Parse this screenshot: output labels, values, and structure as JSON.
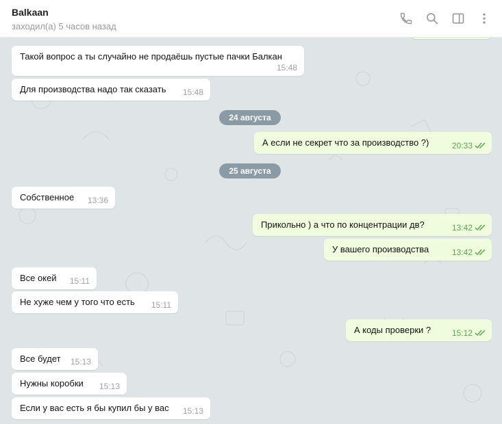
{
  "header": {
    "name": "Balkaan",
    "status": "заходил(а) 5 часов назад"
  },
  "dates": [
    "24 августа",
    "25 августа"
  ],
  "messages": [
    {
      "side": "in",
      "text": "Такой вопрос а ты случайно не продаёшь пустые пачки Балкан",
      "time": "15:48"
    },
    {
      "side": "in",
      "text": "Для производства надо так сказать",
      "time": "15:48"
    },
    {
      "side": "out",
      "text": "А если не секрет что за производство ?)",
      "time": "20:33"
    },
    {
      "side": "in",
      "text": "Собственное",
      "time": "13:36"
    },
    {
      "side": "out",
      "text": "Прикольно ) а что по концентрации дв?",
      "time": "13:42"
    },
    {
      "side": "out",
      "text": "У вашего производства",
      "time": "13:42"
    },
    {
      "side": "in",
      "text": "Все окей",
      "time": "15:11"
    },
    {
      "side": "in",
      "text": "Не хуже чем у того что есть",
      "time": "15:11"
    },
    {
      "side": "out",
      "text": "А коды проверки ?",
      "time": "15:12"
    },
    {
      "side": "in",
      "text": "Все будет",
      "time": "15:13"
    },
    {
      "side": "in",
      "text": "Нужны коробки",
      "time": "15:13"
    },
    {
      "side": "in",
      "text": "Если у вас есть я бы купил бы у вас",
      "time": "15:13"
    }
  ],
  "icons": [
    "phone-icon",
    "search-icon",
    "sidebar-toggle-icon",
    "more-vertical-icon",
    "double-check-icon"
  ],
  "colors": {
    "header_bg": "#ffffff",
    "chat_bg": "#dfe5e6",
    "incoming_bubble": "#ffffff",
    "outgoing_bubble": "#effdde",
    "outgoing_time": "#5ba64f",
    "date_pill": "#8a9ba6",
    "icon": "#999999"
  }
}
